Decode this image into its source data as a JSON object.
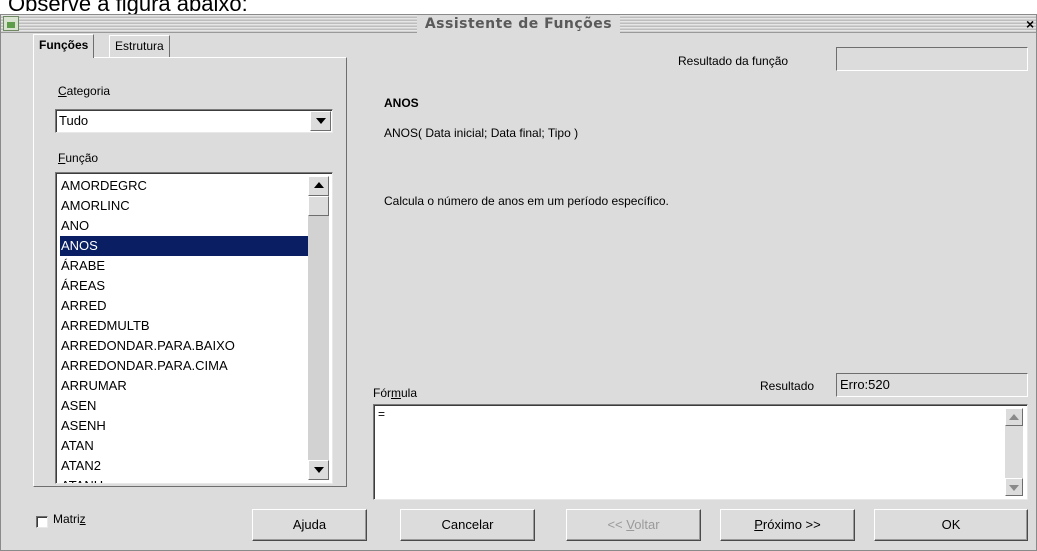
{
  "caption": "Observe a figura abaixo:",
  "window": {
    "title": "Assistente de Funções",
    "close_label": "×"
  },
  "tabs": [
    {
      "label": "Funções",
      "active": true
    },
    {
      "label": "Estrutura",
      "active": false
    }
  ],
  "category": {
    "label": "Categoria",
    "selected": "Tudo"
  },
  "function_list": {
    "label": "Função",
    "items": [
      "AMORDEGRC",
      "AMORLINC",
      "ANO",
      "ANOS",
      "ÁRABE",
      "ÁREAS",
      "ARRED",
      "ARREDMULTB",
      "ARREDONDAR.PARA.BAIXO",
      "ARREDONDAR.PARA.CIMA",
      "ARRUMAR",
      "ASEN",
      "ASENH",
      "ATAN",
      "ATAN2",
      "ATANH"
    ],
    "selected": "ANOS"
  },
  "function_result": {
    "label": "Resultado da função",
    "value": ""
  },
  "description": {
    "name": "ANOS",
    "syntax": "ANOS( Data inicial; Data final; Tipo )",
    "text": "Calcula o número de anos em um período específico."
  },
  "formula": {
    "label": "Fórmula",
    "value": "="
  },
  "result": {
    "label": "Resultado",
    "value": "Erro:520"
  },
  "matrix_checkbox": {
    "label": "Matriz",
    "checked": false
  },
  "buttons": {
    "help": "Ajuda",
    "cancel": "Cancelar",
    "back": "<< Voltar",
    "next": "Próximo >>",
    "ok": "OK"
  }
}
